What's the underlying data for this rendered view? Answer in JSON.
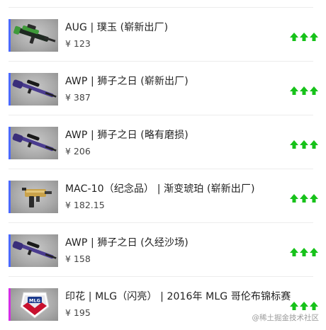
{
  "colors": {
    "accent_up": "#17c21a",
    "rarity_purple": "#4b69ff",
    "rarity_pink": "#d32ee6"
  },
  "items": [
    {
      "name": "AUG | 璞玉 (崭新出厂)",
      "price": "¥ 123",
      "thumb_icon": "aug-rifle-icon",
      "trend_icon": "triple-up-arrow-icon",
      "rarity_color": "#4b69ff"
    },
    {
      "name": "AWP | 狮子之日 (崭新出厂)",
      "price": "¥ 387",
      "thumb_icon": "awp-rifle-icon",
      "trend_icon": "triple-up-arrow-icon",
      "rarity_color": "#4b69ff"
    },
    {
      "name": "AWP | 狮子之日 (略有磨损)",
      "price": "¥ 206",
      "thumb_icon": "awp-rifle-icon",
      "trend_icon": "triple-up-arrow-icon",
      "rarity_color": "#4b69ff"
    },
    {
      "name": "MAC-10（纪念品） | 渐变琥珀 (崭新出厂)",
      "price": "¥ 182.15",
      "thumb_icon": "mac10-smg-icon",
      "trend_icon": "triple-up-arrow-icon",
      "rarity_color": "#4b69ff"
    },
    {
      "name": "AWP | 狮子之日 (久经沙场)",
      "price": "¥ 158",
      "thumb_icon": "awp-rifle-icon",
      "trend_icon": "triple-up-arrow-icon",
      "rarity_color": "#4b69ff"
    },
    {
      "name": "印花 | MLG（闪亮） | 2016年 MLG 哥伦布锦标赛",
      "price": "¥ 195",
      "thumb_icon": "mlg-sticker-icon",
      "trend_icon": "triple-up-arrow-icon",
      "rarity_color": "#d32ee6"
    }
  ],
  "watermark": "@稀土掘金技术社区"
}
